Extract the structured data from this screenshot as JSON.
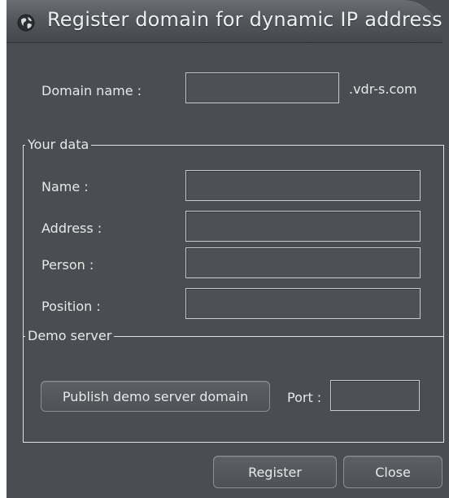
{
  "window": {
    "title": "Register domain for dynamic IP address"
  },
  "domain": {
    "label": "Domain name :",
    "value": "",
    "suffix": ".vdr-s.com"
  },
  "your_data": {
    "legend": "Your data",
    "fields": [
      {
        "label": "Name :",
        "value": ""
      },
      {
        "label": "Address :",
        "value": ""
      },
      {
        "label": "Person :",
        "value": ""
      },
      {
        "label": "Position :",
        "value": ""
      }
    ]
  },
  "demo_server": {
    "legend": "Demo server",
    "publish_button": "Publish demo server domain",
    "port_label": "Port :",
    "port_value": ""
  },
  "buttons": {
    "register": "Register",
    "close": "Close"
  },
  "icons": {
    "title": "globe-icon"
  }
}
